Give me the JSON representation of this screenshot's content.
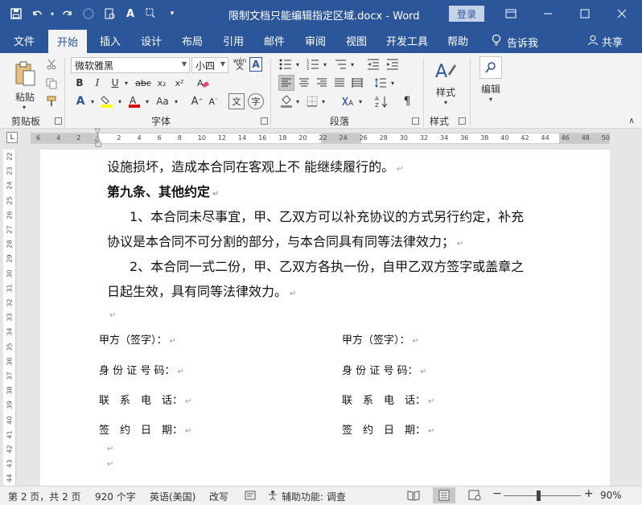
{
  "titlebar": {
    "doc_title": "限制文档只能编辑指定区域.docx - Word",
    "login": "登录"
  },
  "tabs": [
    "文件",
    "开始",
    "插入",
    "设计",
    "布局",
    "引用",
    "邮件",
    "审阅",
    "视图",
    "开发工具",
    "帮助"
  ],
  "active_tab": "开始",
  "tellme": "告诉我",
  "share": "共享",
  "ribbon": {
    "clipboard": {
      "paste": "粘贴",
      "label": "剪贴板"
    },
    "font": {
      "name": "微软雅黑",
      "size": "小四",
      "label": "字体",
      "phonetic": "wén"
    },
    "paragraph": {
      "label": "段落"
    },
    "styles": {
      "button": "样式",
      "label": "样式"
    },
    "editing": {
      "button": "编辑"
    }
  },
  "ruler": {
    "numbers": [
      "6",
      "4",
      "2",
      "",
      "2",
      "4",
      "6",
      "8",
      "10",
      "12",
      "14",
      "16",
      "18",
      "20",
      "22",
      "24",
      "26",
      "28",
      "30",
      "32",
      "34",
      "36",
      "38",
      "40",
      "42",
      "44",
      "46",
      "48",
      "50"
    ]
  },
  "vruler": {
    "numbers": [
      "22",
      "23",
      "24",
      "25",
      "26",
      "27",
      "28",
      "29",
      "30",
      "31",
      "32",
      "33",
      "34",
      "35",
      "36",
      "37",
      "38",
      "39",
      "40",
      "41",
      "42",
      "43",
      "44"
    ]
  },
  "doc": {
    "line1": "设施损坏，造成本合同在客观上不 能继续履行的。",
    "heading": "第九条、其他约定",
    "p1a": "1、本合同未尽事宜，甲、乙双方可以补充协议的方式另行约定，补充",
    "p1b": "协议是本合同不可分割的部分，与本合同具有同等法律效力；",
    "p2a": "2、本合同一式二份，甲、乙双方各执一份，自甲乙双方签字或盖章之",
    "p2b": "日起生效，具有同等法律效力。",
    "sign": {
      "party_a": "甲方（签字）：",
      "party_b": "甲方（签字）：",
      "id_a": "身 份 证 号 码：",
      "id_b": "身 份 证 号 码：",
      "tel_a": "联　系　电　话：",
      "tel_b": "联　系　电　话：",
      "date_a": "签　约　日　期：",
      "date_b": "签　约　日　期："
    }
  },
  "status": {
    "page": "第 2 页，共 2 页",
    "words": "920 个字",
    "lang": "英语(美国)",
    "track": "改写",
    "access": "辅助功能: 调查",
    "zoom": "90%"
  },
  "colors": {
    "brand": "#2b579a",
    "highlight": "#ffff00",
    "font_color": "#e00000"
  }
}
